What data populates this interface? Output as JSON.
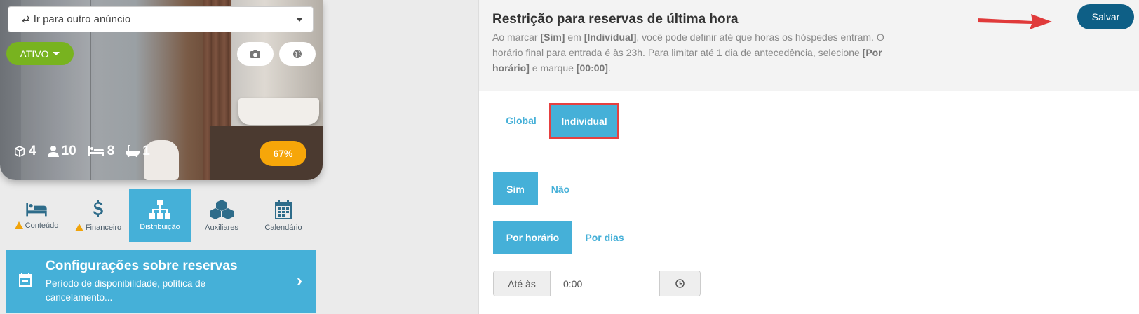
{
  "listing_selector": {
    "label": "Ir para outro anúncio",
    "icon": "swap-icon"
  },
  "status_button": {
    "label": "ATIVO"
  },
  "photo_buttons": {
    "camera": "camera-icon",
    "globe": "globe-icon"
  },
  "stats": {
    "rooms": "4",
    "guests": "10",
    "beds": "8",
    "bathrooms": "1"
  },
  "completion_badge": "67%",
  "nav_tabs": [
    {
      "label": "Conteúdo",
      "icon": "bed-icon",
      "warning": true,
      "active": false
    },
    {
      "label": "Financeiro",
      "icon": "dollar-icon",
      "warning": true,
      "active": false
    },
    {
      "label": "Distribuição",
      "icon": "sitemap-icon",
      "warning": false,
      "active": true
    },
    {
      "label": "Auxiliares",
      "icon": "cubes-icon",
      "warning": false,
      "active": false
    },
    {
      "label": "Calendário",
      "icon": "calendar-icon",
      "warning": false,
      "active": false
    }
  ],
  "config_card": {
    "title": "Configurações sobre reservas",
    "subtitle": "Período de disponibilidade, política de cancelamento..."
  },
  "header": {
    "title": "Restrição para reservas de última hora",
    "desc_parts": {
      "p1": "Ao marcar ",
      "b1": "[Sim]",
      "p2": " em ",
      "b2": "[Individual]",
      "p3": ", você pode definir até que horas os hóspedes entram. O horário final para entrada é às 23h. Para limitar até 1 dia de antecedência, selecione ",
      "b3": "[Por horário]",
      "p4": " e marque ",
      "b4": "[00:00]",
      "p5": "."
    },
    "save_label": "Salvar"
  },
  "scope_tabs": {
    "global": "Global",
    "individual": "Individual"
  },
  "yes_no": {
    "yes": "Sim",
    "no": "Não"
  },
  "mode": {
    "by_time": "Por horário",
    "by_days": "Por dias"
  },
  "time_input": {
    "addon": "Até às",
    "value": "0:00",
    "icon": "clock-icon"
  },
  "colors": {
    "accent": "#45b0d8",
    "save": "#0e5f86",
    "active_status": "#78b31f",
    "badge": "#f6a609",
    "highlight": "#e64040"
  }
}
